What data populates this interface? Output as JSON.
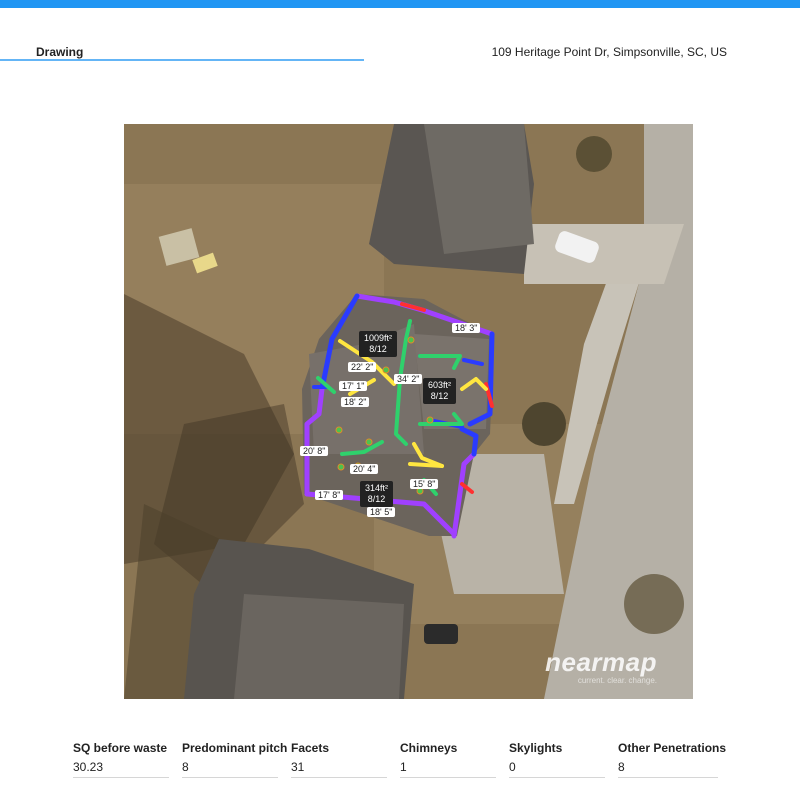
{
  "header": {
    "tab_label": "Drawing",
    "address": "109 Heritage Point Dr, Simpsonville, SC, US"
  },
  "map": {
    "facets": [
      {
        "area": "1009ft²",
        "pitch": "8/12"
      },
      {
        "area": "603ft²",
        "pitch": "8/12"
      },
      {
        "area": "314ft²",
        "pitch": "8/12"
      }
    ],
    "lengths": [
      "18' 3\"",
      "22' 2\"",
      "17' 1\"",
      "34' 2\"",
      "18' 2\"",
      "20' 8\"",
      "20' 4\"",
      "15' 8\"",
      "17' 8\"",
      "18' 5\""
    ],
    "watermark_main": "nearmap",
    "watermark_sub": "current. clear. change."
  },
  "stats": [
    {
      "label": "SQ before waste",
      "value": "30.23"
    },
    {
      "label": "Predominant pitch",
      "value": "8"
    },
    {
      "label": "Facets",
      "value": "31"
    },
    {
      "label": "Chimneys",
      "value": "1"
    },
    {
      "label": "Skylights",
      "value": "0"
    },
    {
      "label": "Other Penetrations",
      "value": "8"
    }
  ],
  "colors": {
    "accent": "#2196f3",
    "eave": "#2a3bff",
    "rake": "#a040ff",
    "ridge": "#ffe640",
    "hip": "#2fd16c",
    "valley": "#ff3030"
  }
}
